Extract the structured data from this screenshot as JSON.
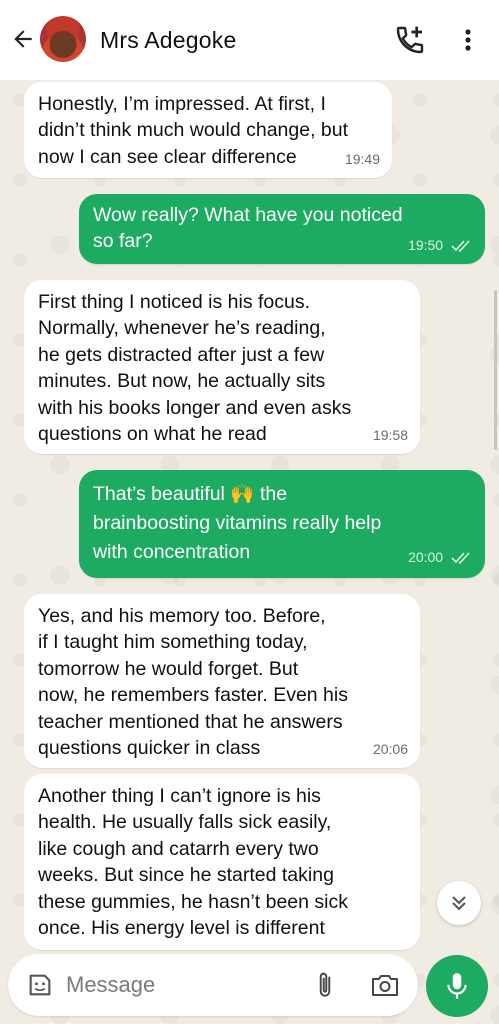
{
  "header": {
    "contact_name": "Mrs Adegoke",
    "back_icon": "arrow-left-icon",
    "call_icon": "add-call-icon",
    "menu_icon": "more-vertical-icon"
  },
  "messages": [
    {
      "dir": "in",
      "text": "Honestly, I’m impressed. At first, I\ndidn’t think much would change, but\nnow I can see clear difference",
      "time": "19:49"
    },
    {
      "dir": "out",
      "text": "Wow really? What have you noticed\nso far?",
      "time": "19:50",
      "read": true
    },
    {
      "dir": "in",
      "text": "First thing I noticed is his focus.\nNormally, whenever he’s reading,\nhe gets distracted after just a few\nminutes. But now, he actually sits\nwith his books longer and even asks\nquestions on what he read",
      "time": "19:58"
    },
    {
      "dir": "out",
      "text": "That’s beautiful 🙌 the\nbrainboosting vitamins really help\nwith concentration",
      "time": "20:00",
      "read": true
    },
    {
      "dir": "in",
      "text": "Yes, and his memory too. Before,\nif I taught him something today,\ntomorrow he would forget. But\nnow, he remembers faster. Even his\nteacher mentioned that he answers\nquestions quicker in class",
      "time": "20:06"
    },
    {
      "dir": "in",
      "text": "Another thing I can’t ignore is his\nhealth. He usually falls sick easily,\nlike cough and catarrh every two\nweeks. But since he started taking\nthese gummies, he hasn’t been sick\nonce. His energy level is different",
      "time": ""
    }
  ],
  "composer": {
    "placeholder": "Message",
    "emoji_icon": "sticker-icon",
    "attach_icon": "paperclip-icon",
    "camera_icon": "camera-icon",
    "mic_icon": "mic-icon"
  },
  "colors": {
    "outgoing_bubble": "#1daa61",
    "incoming_bubble": "#ffffff",
    "wallpaper": "#f0ebe3"
  }
}
